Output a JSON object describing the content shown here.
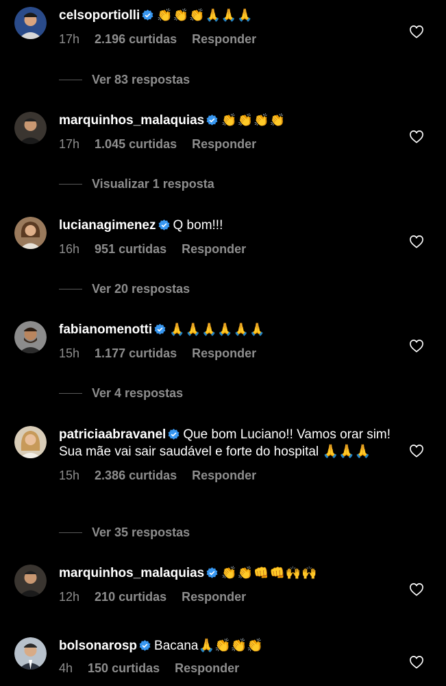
{
  "comments": [
    {
      "username": "celsoportiolli",
      "text": "👏👏👏🙏🙏🙏",
      "time": "17h",
      "likes": "2.196 curtidas",
      "reply_label": "Responder",
      "replies_label": "Ver 83 respostas"
    },
    {
      "username": "marquinhos_malaquias",
      "text": "👏👏👏👏",
      "time": "17h",
      "likes": "1.045 curtidas",
      "reply_label": "Responder",
      "replies_label": "Visualizar 1 resposta"
    },
    {
      "username": "lucianagimenez",
      "text": "Q bom!!!",
      "time": "16h",
      "likes": "951 curtidas",
      "reply_label": "Responder",
      "replies_label": "Ver 20 respostas"
    },
    {
      "username": "fabianomenotti",
      "text": "🙏🙏🙏🙏🙏🙏",
      "time": "15h",
      "likes": "1.177 curtidas",
      "reply_label": "Responder",
      "replies_label": "Ver 4 respostas"
    },
    {
      "username": "patriciaabravanel",
      "text": "Que bom Luciano!! Vamos orar sim! Sua mãe vai sair saudável e forte do hospital 🙏🙏🙏",
      "time": "15h",
      "likes": "2.386 curtidas",
      "reply_label": "Responder",
      "replies_label": "Ver 35 respostas"
    },
    {
      "username": "marquinhos_malaquias",
      "text": "👏👏👊👊🙌🙌",
      "time": "12h",
      "likes": "210 curtidas",
      "reply_label": "Responder"
    },
    {
      "username": "bolsonarosp",
      "text": "Bacana🙏👏👏👏",
      "time": "4h",
      "likes": "150 curtidas",
      "reply_label": "Responder"
    }
  ],
  "colors": {
    "background": "#000000",
    "text": "#ffffff",
    "secondary": "#8e8e8e",
    "verified": "#3897f0"
  },
  "icons": {
    "verified": "verified-badge-icon",
    "like": "heart-outline-icon"
  }
}
